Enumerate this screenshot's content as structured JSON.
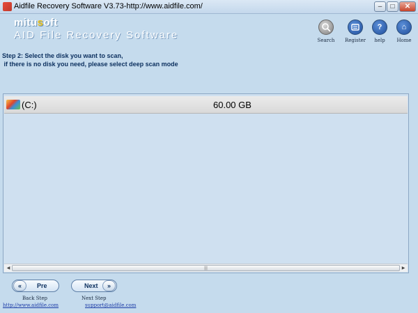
{
  "window": {
    "title": "Aidfile Recovery Software V3.73-http://www.aidfile.com/",
    "min_label": "–",
    "max_label": "□",
    "close_label": "✕"
  },
  "branding": {
    "logo_prefix": "mitu",
    "logo_accent": "s",
    "logo_suffix": "oft",
    "subtitle": "AID File Recovery Software"
  },
  "toolbar": {
    "search": {
      "label": "Search",
      "icon": "magnifier-icon"
    },
    "register": {
      "label": "Register",
      "icon": "register-icon"
    },
    "help": {
      "label": "help",
      "icon": "question-icon",
      "glyph": "?"
    },
    "home": {
      "label": "Home",
      "icon": "home-icon",
      "glyph": "⌂"
    }
  },
  "instructions": {
    "line1": "Step 2: Select the disk you want to scan,",
    "line2": " if there is no disk you need, please select deep scan mode"
  },
  "disks": [
    {
      "name": "(C:)",
      "size": "60.00 GB"
    }
  ],
  "scrollbar": {
    "grip": "|||"
  },
  "nav": {
    "prev_label": "Pre",
    "prev_chevron": "«",
    "next_label": "Next",
    "next_chevron": "»",
    "back_caption": "Back Step",
    "next_caption": "Next Step"
  },
  "footer": {
    "website": "http://www.aidfile.com",
    "email": "support@aidfile.com"
  }
}
